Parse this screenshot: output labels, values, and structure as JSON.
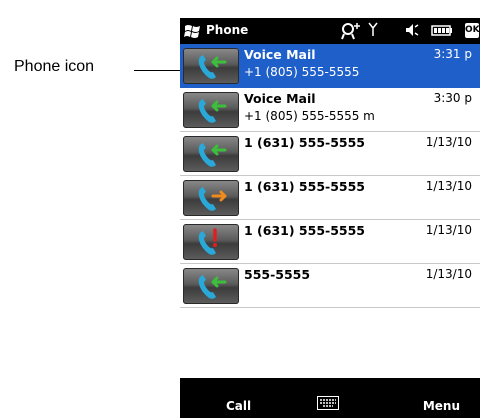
{
  "callout": {
    "label": "Phone icon"
  },
  "titlebar": {
    "title": "Phone",
    "ok_label": "OK"
  },
  "calls": [
    {
      "name": "Voice Mail",
      "number": "+1 (805) 555-5555",
      "time": "3:31 p",
      "type": "incoming",
      "selected": true
    },
    {
      "name": "Voice Mail",
      "number": "+1 (805) 555-5555 m",
      "time": "3:30 p",
      "type": "incoming",
      "selected": false
    },
    {
      "name": "1 (631) 555-5555",
      "number": "",
      "time": "1/13/10",
      "type": "incoming",
      "selected": false
    },
    {
      "name": "1 (631) 555-5555",
      "number": "",
      "time": "1/13/10",
      "type": "outgoing",
      "selected": false
    },
    {
      "name": "1 (631) 555-5555",
      "number": "",
      "time": "1/13/10",
      "type": "missed",
      "selected": false
    },
    {
      "name": "555-5555",
      "number": "",
      "time": "1/13/10",
      "type": "incoming",
      "selected": false
    }
  ],
  "menubar": {
    "left_softkey": "Call",
    "right_softkey": "Menu"
  },
  "colors": {
    "selection": "#1f5fc9",
    "bar": "#000000",
    "incoming_arrow": "#3cc03c",
    "outgoing_arrow": "#f08a1c",
    "missed_mark": "#e02020",
    "handset": "#2aa8d8"
  },
  "icons": {
    "start": "windows-flag-icon",
    "status": [
      "connectivity-icon",
      "signal-icon",
      "speaker-icon",
      "battery-icon"
    ],
    "keyboard": "keyboard-icon"
  }
}
